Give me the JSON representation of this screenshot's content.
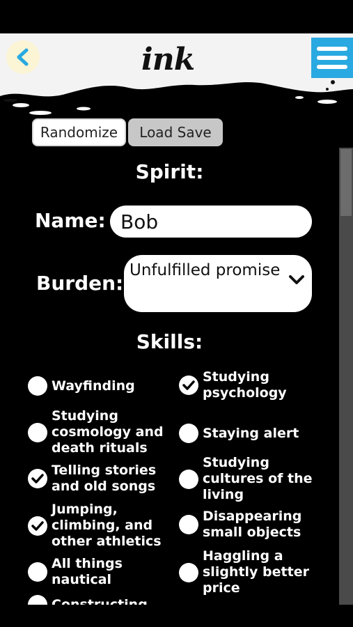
{
  "header": {
    "logo": "ink",
    "back_icon": "chevron-left-icon",
    "menu_icon": "hamburger-menu-icon",
    "accent_color": "#29a9e1"
  },
  "actions": {
    "randomize_label": "Randomize",
    "load_save_label": "Load Save"
  },
  "spirit": {
    "title": "Spirit:",
    "name_label": "Name:",
    "name_value": "Bob",
    "burden_label": "Burden:",
    "burden_value": "Unfulfilled promise"
  },
  "skills": {
    "title": "Skills:",
    "left": [
      {
        "label": "Wayfinding",
        "checked": false
      },
      {
        "label": "Studying cosmology and death rituals",
        "checked": false
      },
      {
        "label": "Telling stories and old songs",
        "checked": true
      },
      {
        "label": "Jumping, climbing, and other athletics",
        "checked": true
      },
      {
        "label": "All things nautical",
        "checked": false
      },
      {
        "label": "Constructing",
        "checked": false
      }
    ],
    "right": [
      {
        "label": "Studying psychology",
        "checked": true
      },
      {
        "label": "Staying alert",
        "checked": false
      },
      {
        "label": "Studying cultures of the living",
        "checked": false
      },
      {
        "label": "Disappearing small objects",
        "checked": false
      },
      {
        "label": "Haggling a slightly better price",
        "checked": false
      }
    ]
  }
}
